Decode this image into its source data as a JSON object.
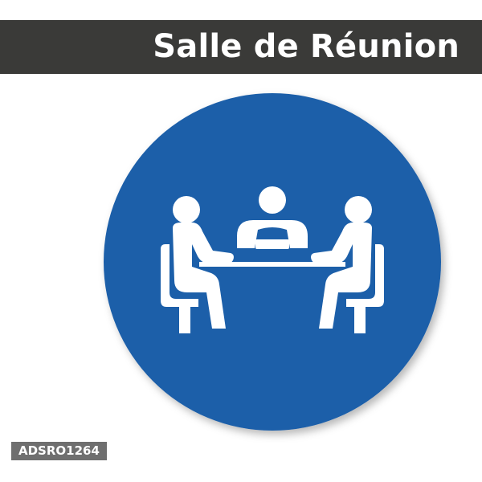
{
  "header": {
    "title": "Salle de Réunion"
  },
  "sign": {
    "icon": "meeting-room-icon",
    "circle_color": "#1d5fa9",
    "figure_color": "#ffffff"
  },
  "footer": {
    "product_code": "ADSRO1264"
  },
  "colors": {
    "title_bar": "#3a3a38",
    "badge": "#6f6f6f",
    "text": "#ffffff"
  }
}
